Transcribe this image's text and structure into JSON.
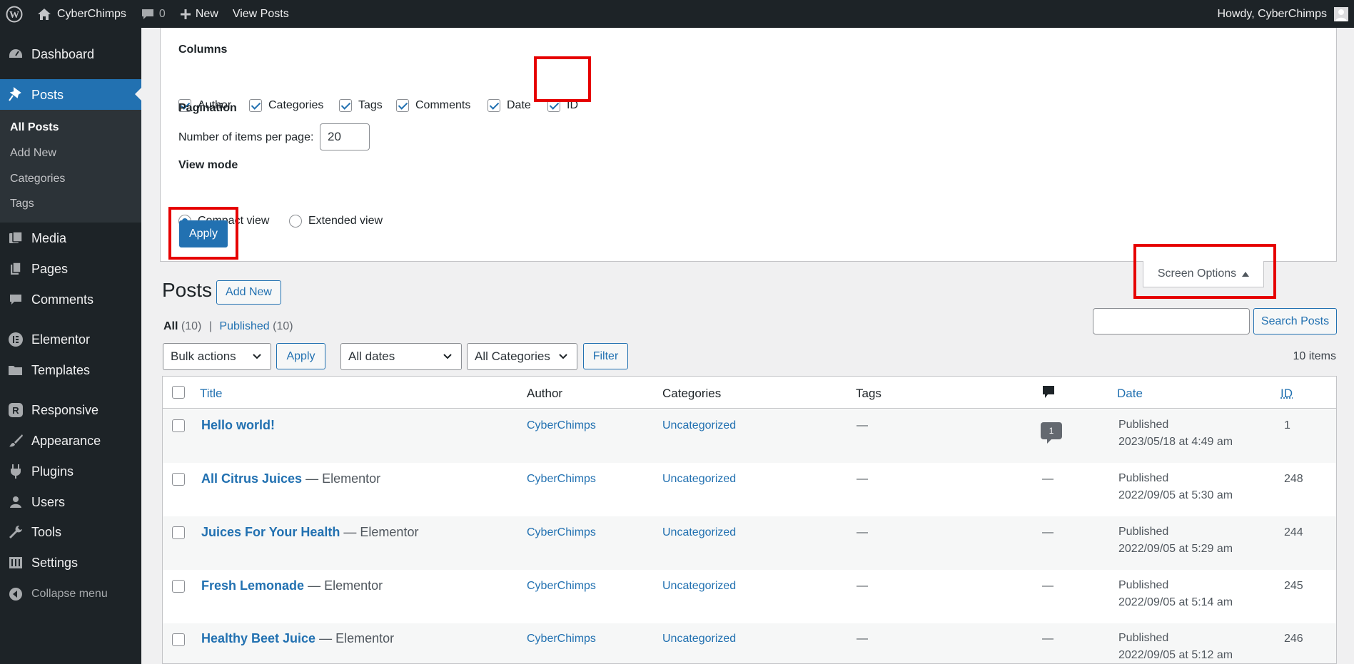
{
  "admin_bar": {
    "site_name": "CyberChimps",
    "comments_count": "0",
    "new_label": "New",
    "view_posts_label": "View Posts",
    "howdy": "Howdy, CyberChimps"
  },
  "sidebar": {
    "items": [
      {
        "label": "Dashboard",
        "icon": "dashboard-icon"
      },
      {
        "label": "Posts",
        "icon": "pin-icon"
      },
      {
        "label": "Media",
        "icon": "media-icon"
      },
      {
        "label": "Pages",
        "icon": "pages-icon"
      },
      {
        "label": "Comments",
        "icon": "comment-icon"
      },
      {
        "label": "Elementor",
        "icon": "elementor-icon"
      },
      {
        "label": "Templates",
        "icon": "folder-icon"
      },
      {
        "label": "Responsive",
        "icon": "responsive-icon"
      },
      {
        "label": "Appearance",
        "icon": "brush-icon"
      },
      {
        "label": "Plugins",
        "icon": "plugin-icon"
      },
      {
        "label": "Users",
        "icon": "users-icon"
      },
      {
        "label": "Tools",
        "icon": "wrench-icon"
      },
      {
        "label": "Settings",
        "icon": "settings-icon"
      }
    ],
    "submenu": [
      "All Posts",
      "Add New",
      "Categories",
      "Tags"
    ],
    "collapse_label": "Collapse menu"
  },
  "screen_options": {
    "columns_heading": "Columns",
    "columns": [
      {
        "label": "Author",
        "checked": true
      },
      {
        "label": "Categories",
        "checked": true
      },
      {
        "label": "Tags",
        "checked": true
      },
      {
        "label": "Comments",
        "checked": true
      },
      {
        "label": "Date",
        "checked": true
      },
      {
        "label": "ID",
        "checked": true
      }
    ],
    "pagination_heading": "Pagination",
    "per_page_label": "Number of items per page:",
    "per_page_value": "20",
    "view_mode_heading": "View mode",
    "view_modes": [
      {
        "label": "Compact view",
        "checked": true
      },
      {
        "label": "Extended view",
        "checked": false
      }
    ],
    "apply_label": "Apply",
    "tab_label": "Screen Options"
  },
  "posts": {
    "title": "Posts",
    "add_new_label": "Add New",
    "filter_all_label": "All",
    "filter_all_count": "(10)",
    "filter_separator": "|",
    "filter_published_label": "Published",
    "filter_published_count": "(10)",
    "search_button": "Search Posts",
    "search_value": "",
    "bulk_actions": "Bulk actions",
    "apply_label": "Apply",
    "dates_filter": "All dates",
    "categories_filter": "All Categories",
    "filter_button": "Filter",
    "items_count": "10 items"
  },
  "table": {
    "headers": {
      "title": "Title",
      "author": "Author",
      "categories": "Categories",
      "tags": "Tags",
      "date": "Date",
      "id": "ID"
    },
    "rows": [
      {
        "title": "Hello world!",
        "state": "",
        "author": "CyberChimps",
        "categories": "Uncategorized",
        "tags": "—",
        "comments": "1",
        "status": "Published",
        "date": "2023/05/18 at 4:49 am",
        "id": "1"
      },
      {
        "title": "All Citrus Juices",
        "state": "— Elementor",
        "author": "CyberChimps",
        "categories": "Uncategorized",
        "tags": "—",
        "comments": "—",
        "status": "Published",
        "date": "2022/09/05 at 5:30 am",
        "id": "248"
      },
      {
        "title": "Juices For Your Health",
        "state": "— Elementor",
        "author": "CyberChimps",
        "categories": "Uncategorized",
        "tags": "—",
        "comments": "—",
        "status": "Published",
        "date": "2022/09/05 at 5:29 am",
        "id": "244"
      },
      {
        "title": "Fresh Lemonade",
        "state": "— Elementor",
        "author": "CyberChimps",
        "categories": "Uncategorized",
        "tags": "—",
        "comments": "—",
        "status": "Published",
        "date": "2022/09/05 at 5:14 am",
        "id": "245"
      },
      {
        "title": "Healthy Beet Juice",
        "state": "— Elementor",
        "author": "CyberChimps",
        "categories": "Uncategorized",
        "tags": "—",
        "comments": "—",
        "status": "Published",
        "date": "2022/09/05 at 5:12 am",
        "id": "246"
      }
    ]
  },
  "colors": {
    "admin_dark": "#1d2327",
    "accent": "#2271b1",
    "highlight_box": "#e60000"
  }
}
